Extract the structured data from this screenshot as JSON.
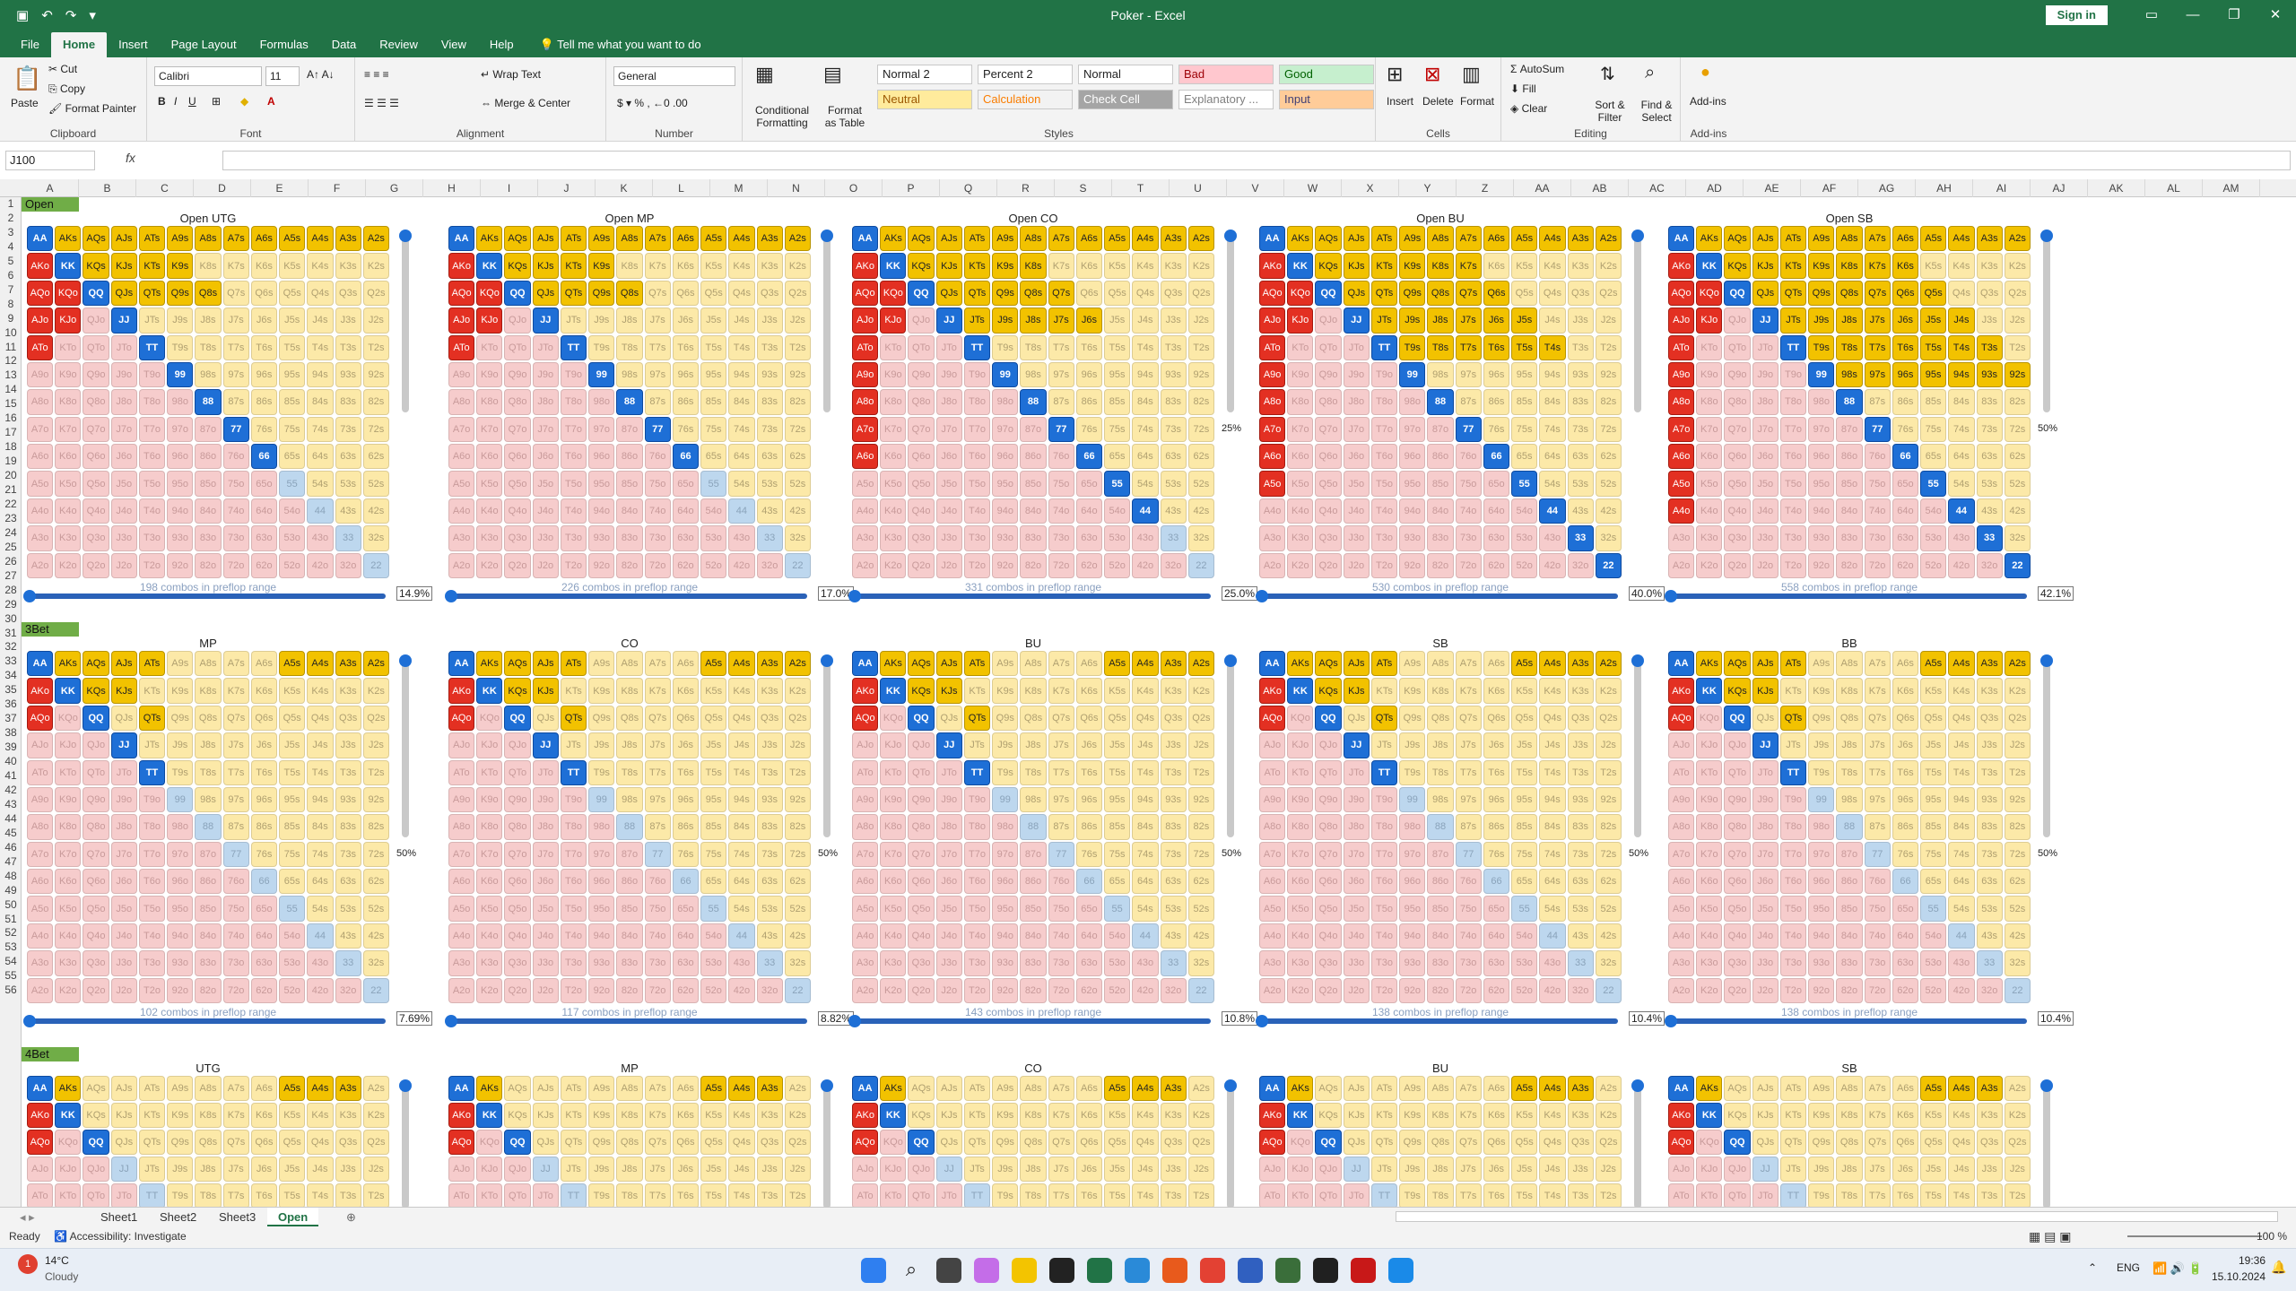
{
  "window": {
    "title": "Poker  -  Excel",
    "signin": "Sign in"
  },
  "tabs": [
    "File",
    "Home",
    "Insert",
    "Page Layout",
    "Formulas",
    "Data",
    "Review",
    "View",
    "Help"
  ],
  "tell_me": "Tell me what you want to do",
  "ribbon": {
    "clipboard": {
      "label": "Clipboard",
      "paste": "Paste",
      "cut": "Cut",
      "copy": "Copy",
      "format_painter": "Format Painter"
    },
    "font": {
      "label": "Font",
      "name": "Calibri",
      "size": "11"
    },
    "alignment": {
      "label": "Alignment",
      "wrap": "Wrap Text",
      "merge": "Merge & Center"
    },
    "number": {
      "label": "Number",
      "format": "General"
    },
    "styles": {
      "label": "Styles",
      "conditional": "Conditional Formatting",
      "format_table": "Format as Table",
      "cells": [
        {
          "name": "Normal 2",
          "bg": "#ffffff",
          "fg": "#222222"
        },
        {
          "name": "Percent 2",
          "bg": "#ffffff",
          "fg": "#222222"
        },
        {
          "name": "Normal",
          "bg": "#ffffff",
          "fg": "#222222"
        },
        {
          "name": "Bad",
          "bg": "#ffc7ce",
          "fg": "#9c0006"
        },
        {
          "name": "Good",
          "bg": "#c6efce",
          "fg": "#006100"
        },
        {
          "name": "Neutral",
          "bg": "#ffeb9c",
          "fg": "#9c5700"
        },
        {
          "name": "Calculation",
          "bg": "#f2f2f2",
          "fg": "#fa7d00"
        },
        {
          "name": "Check Cell",
          "bg": "#a5a5a5",
          "fg": "#ffffff"
        },
        {
          "name": "Explanatory ...",
          "bg": "#ffffff",
          "fg": "#7f7f7f"
        },
        {
          "name": "Input",
          "bg": "#ffcc99",
          "fg": "#3f3f76"
        }
      ]
    },
    "cells": {
      "label": "Cells",
      "insert": "Insert",
      "delete": "Delete",
      "format": "Format"
    },
    "editing": {
      "label": "Editing",
      "autosum": "AutoSum",
      "fill": "Fill",
      "clear": "Clear",
      "sort": "Sort & Filter",
      "find": "Find & Select"
    },
    "addins": {
      "label": "Add-ins",
      "addins": "Add-ins"
    }
  },
  "formula_bar": {
    "name_box": "J100",
    "fx": "fx",
    "value": ""
  },
  "columns": [
    "A",
    "B",
    "C",
    "D",
    "E",
    "F",
    "G",
    "H",
    "I",
    "J",
    "K",
    "L",
    "M",
    "N",
    "O",
    "P",
    "Q",
    "R",
    "S",
    "T",
    "U",
    "V",
    "W",
    "X",
    "Y",
    "Z",
    "AA",
    "AB",
    "AC",
    "AD",
    "AE",
    "AF",
    "AG",
    "AH",
    "AI",
    "AJ",
    "AK",
    "AL",
    "AM"
  ],
  "rows": [
    "1",
    "2",
    "3",
    "4",
    "5",
    "6",
    "7",
    "8",
    "9",
    "10",
    "11",
    "12",
    "13",
    "14",
    "15",
    "16",
    "17",
    "18",
    "19",
    "20",
    "21",
    "22",
    "23",
    "24",
    "25",
    "26",
    "27",
    "28",
    "29",
    "30",
    "31",
    "32",
    "33",
    "34",
    "35",
    "36",
    "37",
    "38",
    "39",
    "40",
    "41",
    "42",
    "43",
    "44",
    "45",
    "46",
    "47",
    "48",
    "49",
    "50",
    "51",
    "52",
    "53",
    "54",
    "55",
    "56"
  ],
  "ranks": [
    "A",
    "K",
    "Q",
    "J",
    "T",
    "9",
    "8",
    "7",
    "6",
    "5",
    "4",
    "3",
    "2"
  ],
  "sections": [
    {
      "label": "Open",
      "grids": [
        {
          "title": "Open UTG",
          "combos": "198 combos in preflop range",
          "pct": "14.9%"
        },
        {
          "title": "Open MP",
          "combos": "226 combos in preflop range",
          "pct": "17.0%"
        },
        {
          "title": "Open CO",
          "combos": "331 combos in preflop range",
          "pct": "25.0%",
          "side": "25%"
        },
        {
          "title": "Open BU",
          "combos": "530 combos in preflop range",
          "pct": "40.0%"
        },
        {
          "title": "Open SB",
          "combos": "558 combos in preflop range",
          "pct": "42.1%",
          "side": "50%"
        }
      ]
    },
    {
      "label": "3Bet",
      "grids": [
        {
          "title": "MP",
          "combos": "102 combos in preflop range",
          "pct": "7.69%",
          "side": "50%"
        },
        {
          "title": "CO",
          "combos": "117 combos in preflop range",
          "pct": "8.82%",
          "side": "50%"
        },
        {
          "title": "BU",
          "combos": "143 combos in preflop range",
          "pct": "10.8%",
          "side": "50%"
        },
        {
          "title": "SB",
          "combos": "138 combos in preflop range",
          "pct": "10.4%",
          "side": "50%"
        },
        {
          "title": "BB",
          "combos": "138 combos in preflop range",
          "pct": "10.4%",
          "side": "50%"
        }
      ]
    },
    {
      "label": "4Bet",
      "grids": [
        {
          "title": "UTG"
        },
        {
          "title": "MP"
        },
        {
          "title": "CO"
        },
        {
          "title": "BU"
        },
        {
          "title": "SB"
        }
      ]
    }
  ],
  "sheet_tabs": [
    "Sheet1",
    "Sheet2",
    "Sheet3",
    "Open"
  ],
  "status": {
    "ready": "Ready",
    "accessibility": "Accessibility: Investigate",
    "zoom": "100 %"
  },
  "taskbar": {
    "weather_temp": "14°C",
    "weather_desc": "Cloudy",
    "lang": "ENG",
    "time": "19:36",
    "date": "15.10.2024",
    "badge": "1"
  }
}
